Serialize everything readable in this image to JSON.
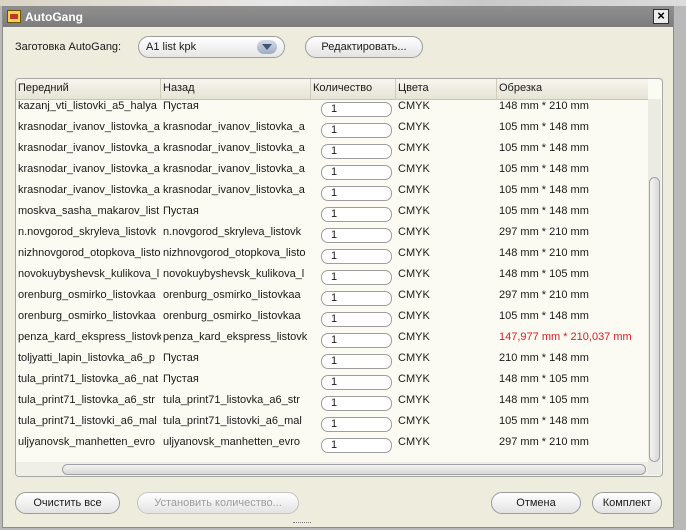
{
  "window": {
    "title": "AutoGang",
    "close_icon": "close-icon"
  },
  "preset": {
    "label": "Заготовка AutoGang:",
    "selected": "A1 list kpk"
  },
  "buttons": {
    "edit": "Редактировать...",
    "clear_all": "Очистить все",
    "set_quantity": "Установить количество...",
    "cancel": "Отмена",
    "complete": "Комплект"
  },
  "table": {
    "columns": [
      "Передний",
      "Назад",
      "Количество",
      "Цвета",
      "Обрезка"
    ],
    "rows": [
      {
        "front": "kazanj_vti_listovki_a5_halya",
        "back": "Пустая",
        "qty": "1",
        "colors": "CMYK",
        "trim": "148 mm * 210 mm"
      },
      {
        "front": "krasnodar_ivanov_listovka_a",
        "back": "krasnodar_ivanov_listovka_a",
        "qty": "1",
        "colors": "CMYK",
        "trim": "105 mm * 148 mm"
      },
      {
        "front": "krasnodar_ivanov_listovka_a",
        "back": "krasnodar_ivanov_listovka_a",
        "qty": "1",
        "colors": "CMYK",
        "trim": "105 mm * 148 mm"
      },
      {
        "front": "krasnodar_ivanov_listovka_a",
        "back": "krasnodar_ivanov_listovka_a",
        "qty": "1",
        "colors": "CMYK",
        "trim": "105 mm * 148 mm"
      },
      {
        "front": "krasnodar_ivanov_listovka_a",
        "back": "krasnodar_ivanov_listovka_a",
        "qty": "1",
        "colors": "CMYK",
        "trim": "105 mm * 148 mm"
      },
      {
        "front": "moskva_sasha_makarov_list",
        "back": "Пустая",
        "qty": "1",
        "colors": "CMYK",
        "trim": "105 mm * 148 mm"
      },
      {
        "front": "n.novgorod_skryleva_listovk",
        "back": "n.novgorod_skryleva_listovk",
        "qty": "1",
        "colors": "CMYK",
        "trim": "297 mm * 210 mm"
      },
      {
        "front": "nizhnovgorod_otopkova_listo",
        "back": "nizhnovgorod_otopkova_listo",
        "qty": "1",
        "colors": "CMYK",
        "trim": "148 mm * 210 mm"
      },
      {
        "front": "novokuybyshevsk_kulikova_l",
        "back": "novokuybyshevsk_kulikova_l",
        "qty": "1",
        "colors": "CMYK",
        "trim": "148 mm * 105 mm"
      },
      {
        "front": "orenburg_osmirko_listovkaa",
        "back": "orenburg_osmirko_listovkaa",
        "qty": "1",
        "colors": "CMYK",
        "trim": "297 mm * 210 mm"
      },
      {
        "front": "orenburg_osmirko_listovkaa",
        "back": "orenburg_osmirko_listovkaa",
        "qty": "1",
        "colors": "CMYK",
        "trim": "105 mm * 148 mm"
      },
      {
        "front": "penza_kard_ekspress_listovk",
        "back": "penza_kard_ekspress_listovk",
        "qty": "1",
        "colors": "CMYK",
        "trim": "147,977 mm * 210,037 mm"
      },
      {
        "front": "toljyatti_lapin_listovka_a6_p",
        "back": "Пустая",
        "qty": "1",
        "colors": "CMYK",
        "trim": "210 mm * 148 mm"
      },
      {
        "front": "tula_print71_listovka_a6_nat",
        "back": "Пустая",
        "qty": "1",
        "colors": "CMYK",
        "trim": "148 mm * 105 mm"
      },
      {
        "front": "tula_print71_listovka_a6_str",
        "back": "tula_print71_listovka_a6_str",
        "qty": "1",
        "colors": "CMYK",
        "trim": "148 mm * 105 mm"
      },
      {
        "front": "tula_print71_listovki_a6_mal",
        "back": "tula_print71_listovki_a6_mal",
        "qty": "1",
        "colors": "CMYK",
        "trim": "105 mm * 148 mm"
      },
      {
        "front": "uljyanovsk_manhetten_evro",
        "back": "uljyanovsk_manhetten_evro",
        "qty": "1",
        "colors": "CMYK",
        "trim": "297 mm * 210 mm"
      }
    ],
    "warning_color": "#d71f1f"
  }
}
